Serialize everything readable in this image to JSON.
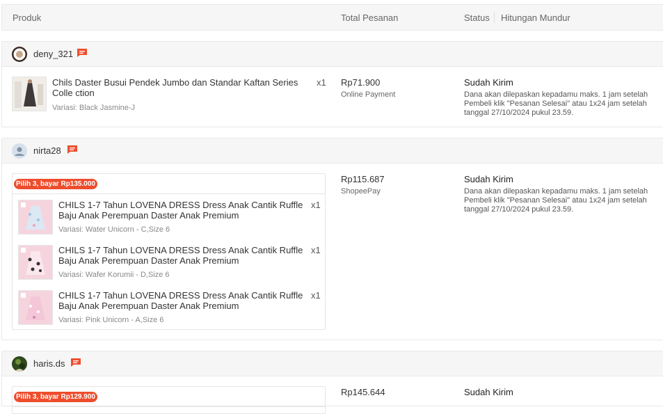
{
  "header": {
    "produk": "Produk",
    "total": "Total Pesanan",
    "status": "Status",
    "countdown": "Hitungan Mundur"
  },
  "orders": [
    {
      "user": "deny_321",
      "price": "Rp71.900",
      "payment": "Online Payment",
      "status": "Sudah Kirim",
      "desc": "Dana akan dilepaskan kepadamu maks. 1 jam setelah Pembeli klik \"Pesanan Selesai\" atau 1x24 jam setelah tanggal 27/10/2024 pukul 23.59.",
      "item": {
        "name": "Chils Daster Busui Pendek Jumbo dan Standar Kaftan Series Colle ction",
        "qty": "x1",
        "variant": "Variasi: Black Jasmine-J"
      }
    },
    {
      "user": "nirta28",
      "price": "Rp115.687",
      "payment": "ShopeePay",
      "status": "Sudah Kirim",
      "desc": "Dana akan dilepaskan kepadamu maks. 1 jam setelah Pembeli klik \"Pesanan Selesai\" atau 1x24 jam setelah tanggal 27/10/2024 pukul 23.59.",
      "promo": "Pilih 3, bayar Rp135.000",
      "items": [
        {
          "name": "CHILS 1-7 Tahun LOVENA DRESS Dress Anak Cantik Ruffle Baju Anak Perempuan Daster Anak Premium",
          "qty": "x1",
          "variant": "Variasi: Water Unicorn - C,Size 6"
        },
        {
          "name": "CHILS 1-7 Tahun LOVENA DRESS Dress Anak Cantik Ruffle Baju Anak Perempuan Daster Anak Premium",
          "qty": "x1",
          "variant": "Variasi: Wafer Korumii - D,Size 6"
        },
        {
          "name": "CHILS 1-7 Tahun LOVENA DRESS Dress Anak Cantik Ruffle Baju Anak Perempuan Daster Anak Premium",
          "qty": "x1",
          "variant": "Variasi: Pink Unicorn - A,Size 6"
        }
      ]
    },
    {
      "user": "haris.ds",
      "price": "Rp145.644",
      "status": "Sudah Kirim",
      "promo": "Pilih 3, bayar Rp129.900"
    }
  ],
  "icons": {
    "chat": "chat-icon",
    "avatar_default": "user-icon"
  },
  "colors": {
    "accent": "#ee4d2d",
    "header_bg": "#f6f6f6"
  }
}
